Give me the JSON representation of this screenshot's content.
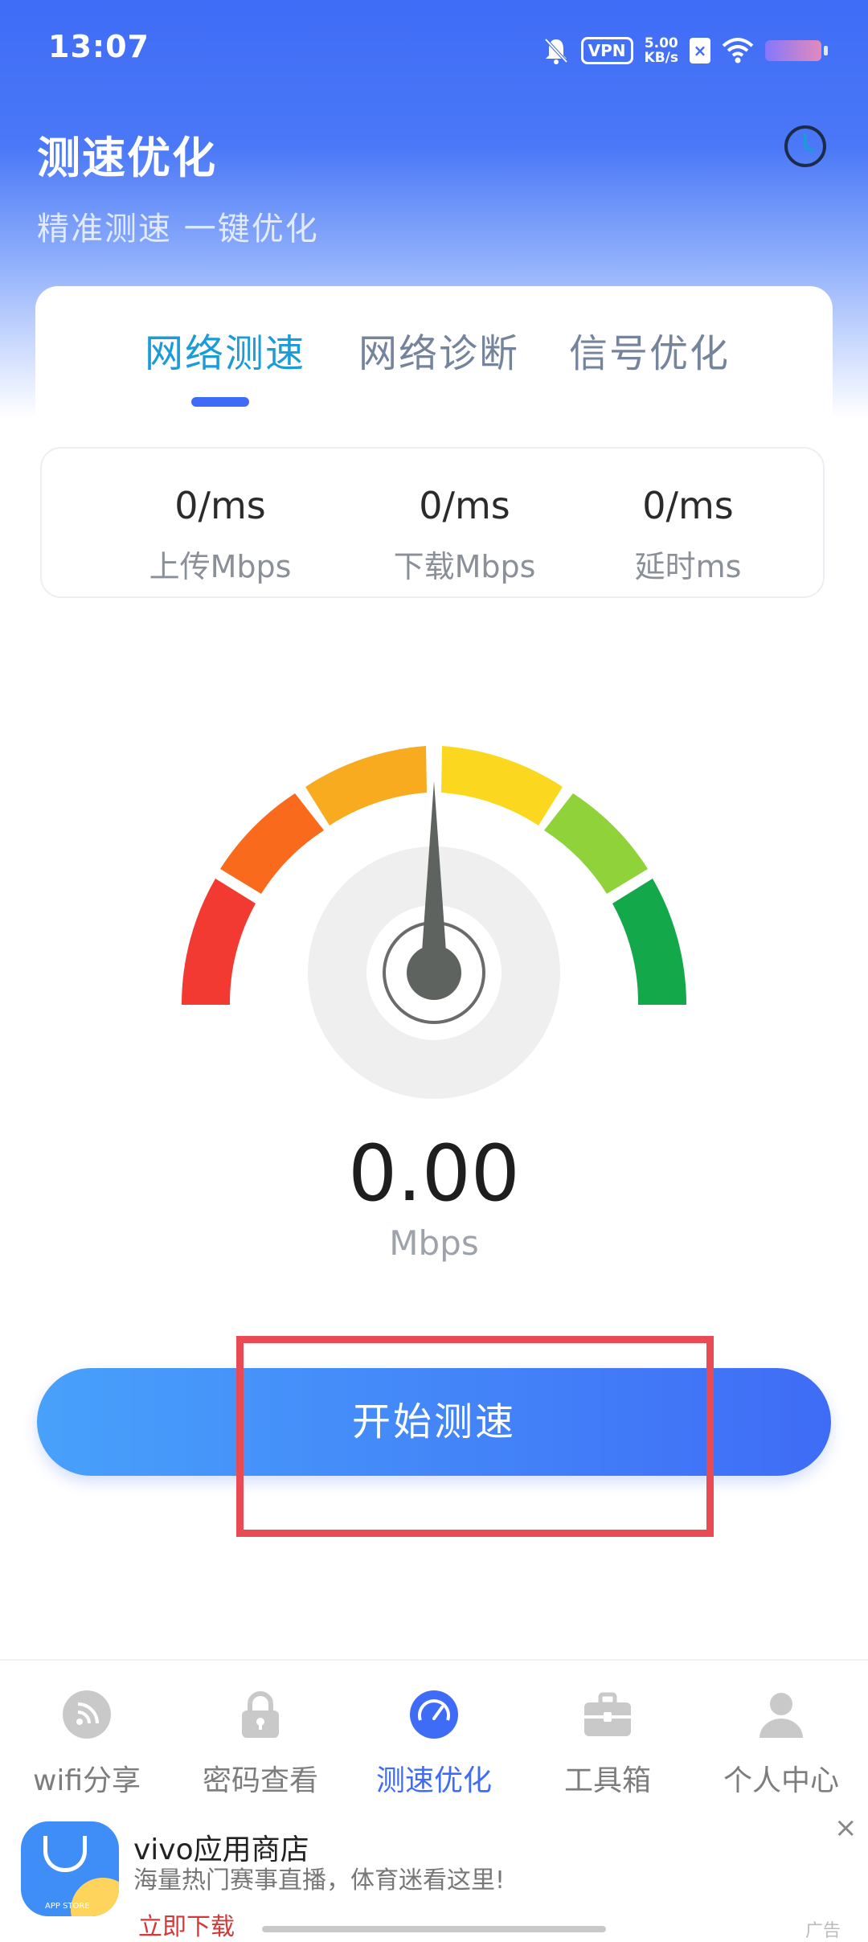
{
  "status_bar": {
    "time": "13:07",
    "vpn": "VPN",
    "net_speed_value": "5.00",
    "net_speed_unit": "KB/s"
  },
  "header": {
    "title": "测速优化",
    "subtitle": "精准测速 一键优化"
  },
  "tabs": [
    {
      "label": "网络测速",
      "active": true
    },
    {
      "label": "网络诊断",
      "active": false
    },
    {
      "label": "信号优化",
      "active": false
    }
  ],
  "stats": [
    {
      "value": "0/ms",
      "label": "上传Mbps"
    },
    {
      "value": "0/ms",
      "label": "下载Mbps"
    },
    {
      "value": "0/ms",
      "label": "延时ms"
    }
  ],
  "gauge": {
    "value": "0.00",
    "unit": "Mbps"
  },
  "start_button": {
    "label": "开始测速"
  },
  "bottom_nav": [
    {
      "label": "wifi分享",
      "icon": "wifi-share-icon"
    },
    {
      "label": "密码查看",
      "icon": "lock-icon"
    },
    {
      "label": "测速优化",
      "icon": "speedometer-icon",
      "active": true
    },
    {
      "label": "工具箱",
      "icon": "toolbox-icon"
    },
    {
      "label": "个人中心",
      "icon": "user-icon"
    }
  ],
  "ad": {
    "logo_text": "APP STORE",
    "title": "vivo应用商店",
    "description": "海量热门赛事直播，体育迷看这里!",
    "link": "立即下载",
    "tag": "广告",
    "close": "×"
  },
  "colors": {
    "primary": "#3f6cf6",
    "tab_active": "#1c9bd9",
    "highlight": "#e94b55"
  }
}
